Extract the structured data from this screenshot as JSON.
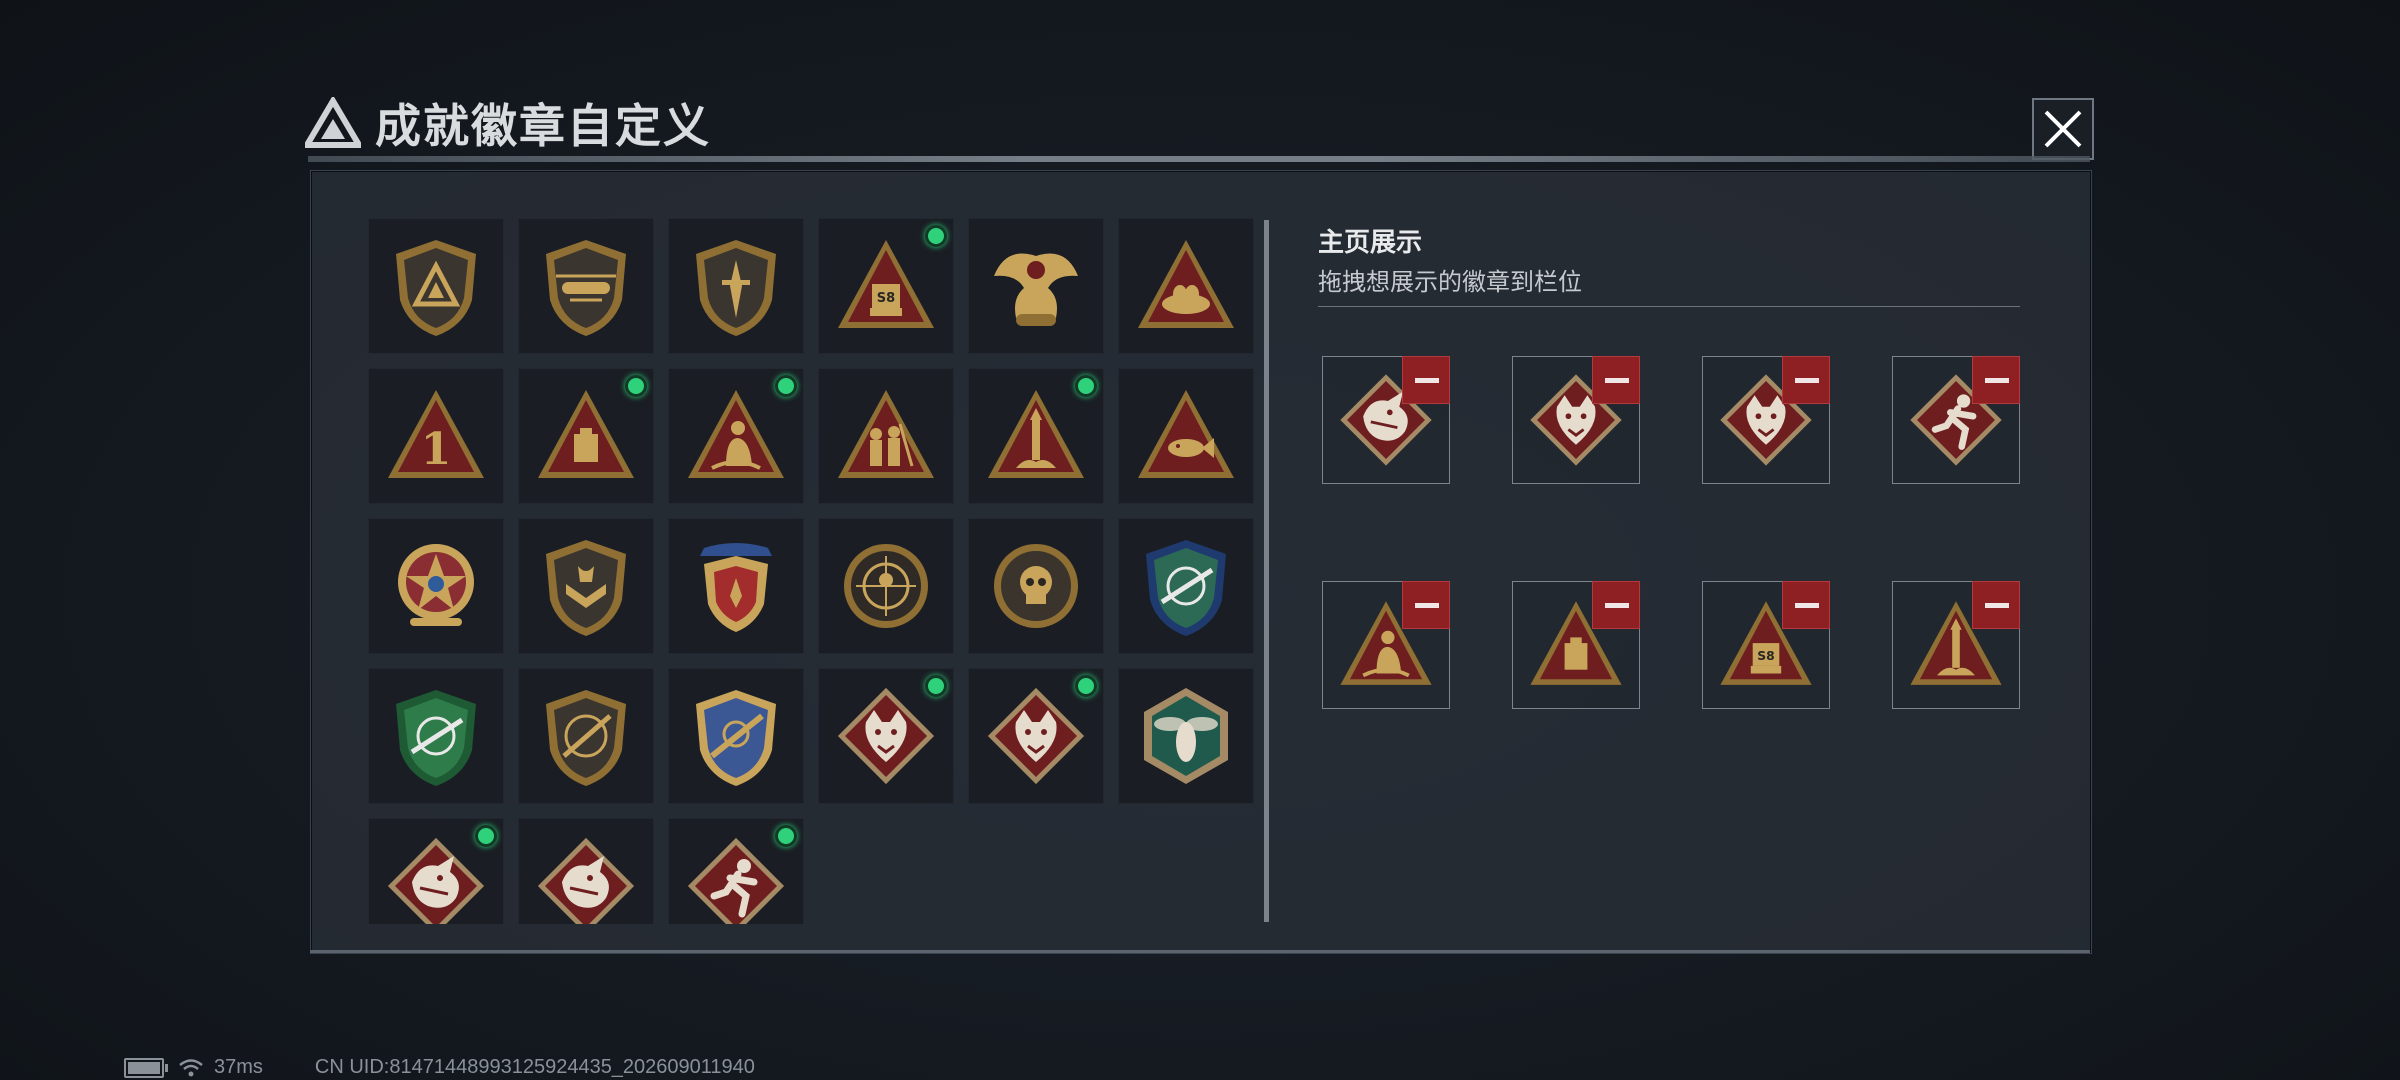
{
  "dialog": {
    "title": "成就徽章自定义",
    "close_icon": "close-icon",
    "logo_icon": "triangle-logo-icon"
  },
  "colors": {
    "gold": "#c9a55c",
    "maroon": "#7a2222",
    "new_dot": "#2fd27a",
    "remove": "#8e2024"
  },
  "badges": [
    {
      "icon": "triangle-logo-shield-icon",
      "new": false
    },
    {
      "icon": "helicopter-shield-icon",
      "new": false
    },
    {
      "icon": "dagger-shield-icon",
      "new": false
    },
    {
      "icon": "s8-sign-triangle-icon",
      "new": true
    },
    {
      "icon": "phoenix-crest-icon",
      "new": false
    },
    {
      "icon": "nest-triangle-icon",
      "new": false
    },
    {
      "icon": "number-one-triangle-icon",
      "new": false
    },
    {
      "icon": "block-triangle-icon",
      "new": true
    },
    {
      "icon": "seated-figure-triangle-icon",
      "new": true
    },
    {
      "icon": "soldiers-triangle-icon",
      "new": false
    },
    {
      "icon": "rocket-triangle-icon",
      "new": true
    },
    {
      "icon": "fish-triangle-icon",
      "new": false
    },
    {
      "icon": "star-medal-icon",
      "new": false
    },
    {
      "icon": "chevron-shield-icon",
      "new": false
    },
    {
      "icon": "starred-crest-icon",
      "new": false
    },
    {
      "icon": "sniper-target-icon",
      "new": false
    },
    {
      "icon": "skull-target-icon",
      "new": false
    },
    {
      "icon": "blue-rifle-shield-icon",
      "new": false
    },
    {
      "icon": "green-rifle-shield-icon",
      "new": false
    },
    {
      "icon": "rifle-target-icon",
      "new": false
    },
    {
      "icon": "blue-gold-crest-icon",
      "new": false
    },
    {
      "icon": "wolf-diamond-icon",
      "new": true
    },
    {
      "icon": "wolf-diamond-icon",
      "new": true
    },
    {
      "icon": "hornet-hexagon-icon",
      "new": false
    },
    {
      "icon": "dragon-diamond-icon",
      "new": true
    },
    {
      "icon": "dragon-diamond-icon",
      "new": false
    },
    {
      "icon": "runner-diamond-icon",
      "new": true
    }
  ],
  "showcase": {
    "title": "主页展示",
    "hint": "拖拽想展示的徽章到栏位",
    "remove_icon": "minus-icon",
    "slots": [
      {
        "icon": "dragon-diamond-icon"
      },
      {
        "icon": "wolf-diamond-icon"
      },
      {
        "icon": "wolf-diamond-icon"
      },
      {
        "icon": "runner-diamond-icon"
      },
      {
        "icon": "seated-figure-triangle-icon"
      },
      {
        "icon": "block-triangle-icon"
      },
      {
        "icon": "s8-sign-triangle-icon"
      },
      {
        "icon": "rocket-triangle-icon"
      }
    ]
  },
  "status_bar": {
    "battery_icon": "battery-charging-icon",
    "wifi_icon": "wifi-icon",
    "ping": "37ms",
    "uid": "CN UID:81471448993125924435_202609011940"
  }
}
